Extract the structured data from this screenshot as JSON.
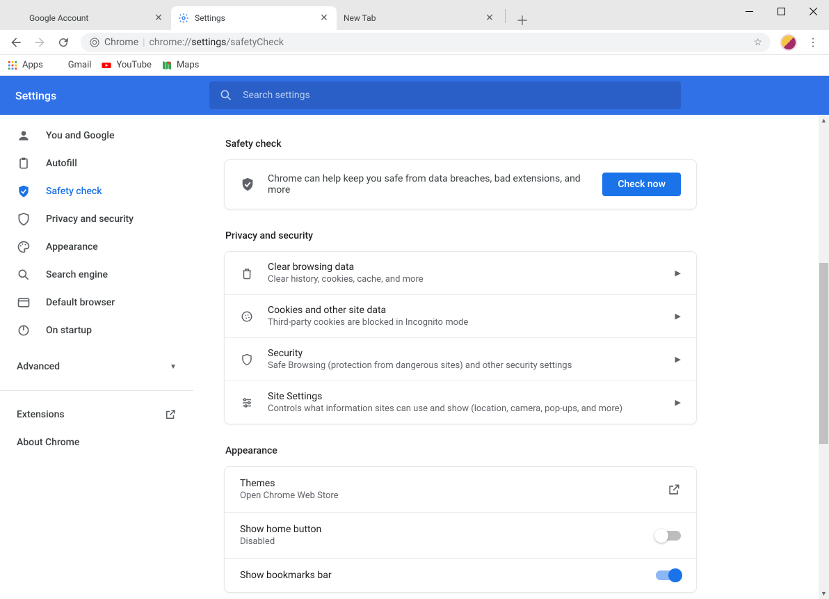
{
  "titlebar": {
    "tabs": [
      {
        "title": "Google Account"
      },
      {
        "title": "Settings"
      },
      {
        "title": "New Tab"
      }
    ]
  },
  "toolbar": {
    "context": "Chrome",
    "url_prefix": "chrome://",
    "url_bold": "settings",
    "url_tail": "/safetyCheck"
  },
  "bookmarks": {
    "apps": "Apps",
    "gmail": "Gmail",
    "youtube": "YouTube",
    "maps": "Maps"
  },
  "header": {
    "title": "Settings",
    "search_placeholder": "Search settings"
  },
  "sidebar": {
    "items": [
      {
        "label": "You and Google"
      },
      {
        "label": "Autofill"
      },
      {
        "label": "Safety check"
      },
      {
        "label": "Privacy and security"
      },
      {
        "label": "Appearance"
      },
      {
        "label": "Search engine"
      },
      {
        "label": "Default browser"
      },
      {
        "label": "On startup"
      }
    ],
    "advanced": "Advanced",
    "extensions": "Extensions",
    "about": "About Chrome"
  },
  "main": {
    "safety_check": {
      "title": "Safety check",
      "text": "Chrome can help keep you safe from data breaches, bad extensions, and more",
      "button": "Check now"
    },
    "privacy": {
      "title": "Privacy and security",
      "rows": [
        {
          "title": "Clear browsing data",
          "sub": "Clear history, cookies, cache, and more"
        },
        {
          "title": "Cookies and other site data",
          "sub": "Third-party cookies are blocked in Incognito mode"
        },
        {
          "title": "Security",
          "sub": "Safe Browsing (protection from dangerous sites) and other security settings"
        },
        {
          "title": "Site Settings",
          "sub": "Controls what information sites can use and show (location, camera, pop-ups, and more)"
        }
      ]
    },
    "appearance": {
      "title": "Appearance",
      "themes": {
        "title": "Themes",
        "sub": "Open Chrome Web Store"
      },
      "home": {
        "title": "Show home button",
        "sub": "Disabled"
      },
      "bookmarks": {
        "title": "Show bookmarks bar"
      }
    }
  }
}
